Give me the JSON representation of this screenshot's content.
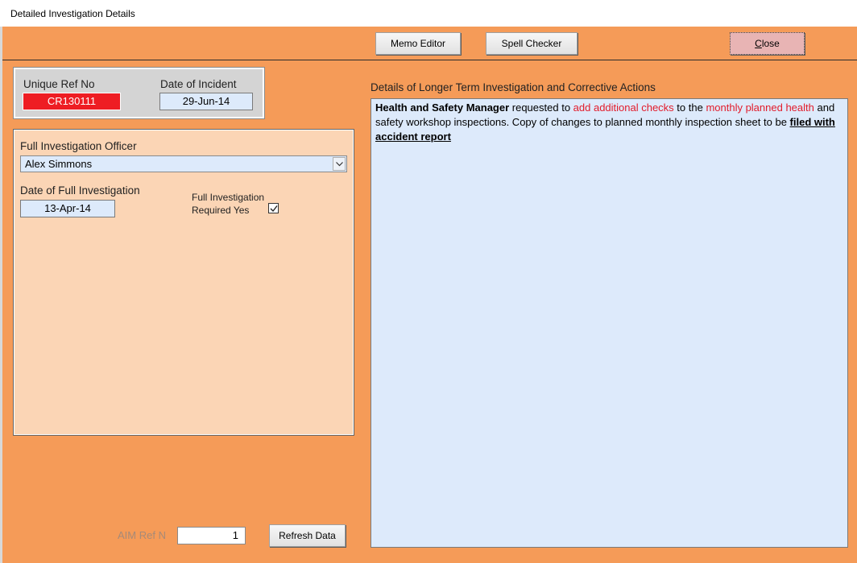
{
  "window": {
    "title": "Detailed Investigation Details"
  },
  "toolbar": {
    "memo_editor": "Memo Editor",
    "spell_checker": "Spell Checker",
    "close_prefix": "C",
    "close_rest": "lose"
  },
  "incident": {
    "unique_ref_label": "Unique Ref No",
    "unique_ref_value": "CR130111",
    "date_label": "Date of Incident",
    "date_value": "29-Jun-14"
  },
  "investigation": {
    "officer_label": "Full Investigation Officer",
    "officer_value": "Alex Simmons",
    "date_label": "Date of Full Investigation",
    "date_value": "13-Apr-14",
    "required_label_line1": "Full Investigation",
    "required_label_line2": "Required Yes",
    "required_checked": true
  },
  "details": {
    "label": "Details of Longer Term Investigation and Corrective Actions",
    "segments": [
      {
        "text": "Health and Safety Manager",
        "style": "bold"
      },
      {
        "text": " requested to ",
        "style": "normal"
      },
      {
        "text": "add additional checks",
        "style": "red"
      },
      {
        "text": " to the ",
        "style": "normal"
      },
      {
        "text": "monthly planned health",
        "style": "red"
      },
      {
        "text": " and safety workshop inspections.  Copy of changes to planned monthly inspection sheet to be ",
        "style": "normal"
      },
      {
        "text": "filed with accident report",
        "style": "bold-underline"
      }
    ]
  },
  "footer": {
    "aim_ref_label": "AIM Ref N",
    "aim_ref_value": "1",
    "refresh_button": "Refresh Data"
  },
  "colors": {
    "form_background": "#f59b58",
    "panel_background": "#fbd5b5",
    "field_background": "#ddeafb",
    "ref_highlight": "#ee1d23",
    "close_button": "#e8b4b4"
  }
}
